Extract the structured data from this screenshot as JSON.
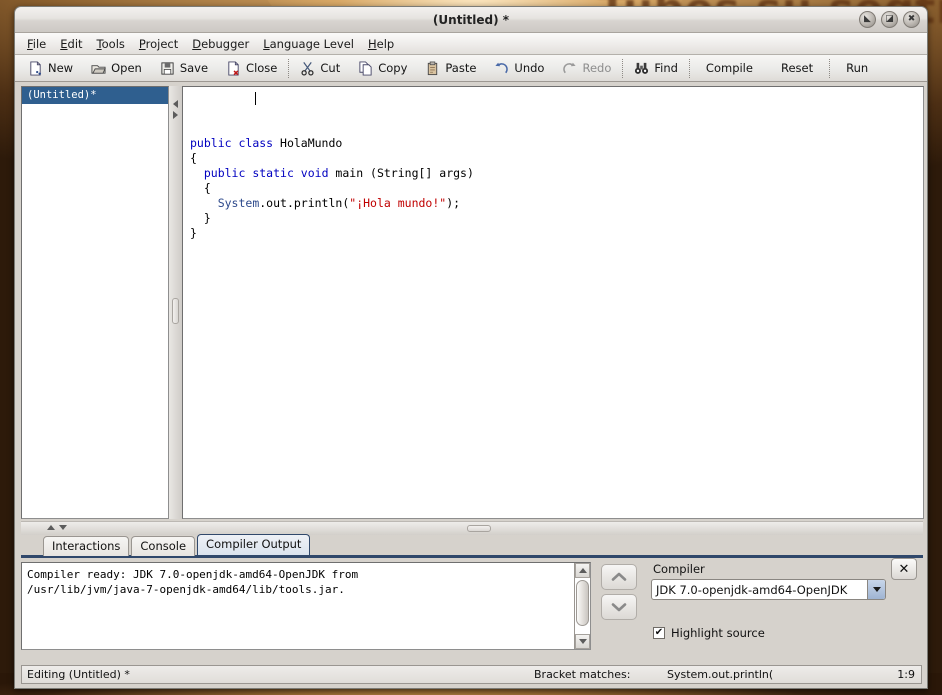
{
  "desktop": {
    "wallpaper_text": "Tubes su seqtiem"
  },
  "window": {
    "title": "(Untitled) *",
    "buttons": [
      {
        "name": "minimize",
        "glyph": "◣"
      },
      {
        "name": "maximize",
        "glyph": "◪"
      },
      {
        "name": "close",
        "glyph": "✖"
      }
    ]
  },
  "menubar": {
    "items": [
      {
        "mnemonic": "F",
        "rest": "ile"
      },
      {
        "mnemonic": "E",
        "rest": "dit"
      },
      {
        "mnemonic": "T",
        "rest": "ools"
      },
      {
        "mnemonic": "P",
        "rest": "roject"
      },
      {
        "mnemonic": "D",
        "rest": "ebugger"
      },
      {
        "mnemonic": "L",
        "rest": "anguage Level"
      },
      {
        "mnemonic": "H",
        "rest": "elp"
      }
    ]
  },
  "toolbar": {
    "new_label": "New",
    "open_label": "Open",
    "save_label": "Save",
    "close_label": "Close",
    "cut_label": "Cut",
    "copy_label": "Copy",
    "paste_label": "Paste",
    "undo_label": "Undo",
    "redo_label": "Redo",
    "find_label": "Find",
    "compile_label": "Compile",
    "reset_label": "Reset",
    "run_label": "Run"
  },
  "doclist": {
    "items": [
      {
        "label": "(Untitled)*",
        "selected": true
      }
    ]
  },
  "editor": {
    "lines": [
      [
        {
          "t": "public ",
          "c": "kw"
        },
        {
          "t": "class ",
          "c": "kw"
        },
        {
          "t": "HolaMundo",
          "c": ""
        }
      ],
      [
        {
          "t": "{",
          "c": ""
        }
      ],
      [
        {
          "t": "  ",
          "c": ""
        },
        {
          "t": "public ",
          "c": "kw"
        },
        {
          "t": "static ",
          "c": "kw"
        },
        {
          "t": "void ",
          "c": "kw"
        },
        {
          "t": "main (String[] args)",
          "c": ""
        }
      ],
      [
        {
          "t": "  {",
          "c": ""
        }
      ],
      [
        {
          "t": "    ",
          "c": ""
        },
        {
          "t": "System",
          "c": "typ"
        },
        {
          "t": ".out.println(",
          "c": ""
        },
        {
          "t": "\"¡Hola mundo!\"",
          "c": "str"
        },
        {
          "t": ");",
          "c": ""
        }
      ],
      [
        {
          "t": "  }",
          "c": ""
        }
      ],
      [
        {
          "t": "}",
          "c": ""
        }
      ]
    ]
  },
  "panel": {
    "tabs": [
      {
        "label": "Interactions",
        "active": false
      },
      {
        "label": "Console",
        "active": false
      },
      {
        "label": "Compiler Output",
        "active": true
      }
    ],
    "output_text": "Compiler ready: JDK 7.0-openjdk-amd64-OpenJDK from\n/usr/lib/jvm/java-7-openjdk-amd64/lib/tools.jar.",
    "compiler_label": "Compiler",
    "compiler_value": "JDK 7.0-openjdk-amd64-OpenJDK",
    "highlight_label": "Highlight source",
    "highlight_checked": "✔",
    "close_glyph": "✕",
    "nav_up_glyph": "⌃",
    "nav_down_glyph": "⌄"
  },
  "statusbar": {
    "left": "Editing (Untitled) *",
    "bracket_label": "Bracket matches:",
    "bracket_value": "System.out.println(",
    "position": "1:9"
  }
}
